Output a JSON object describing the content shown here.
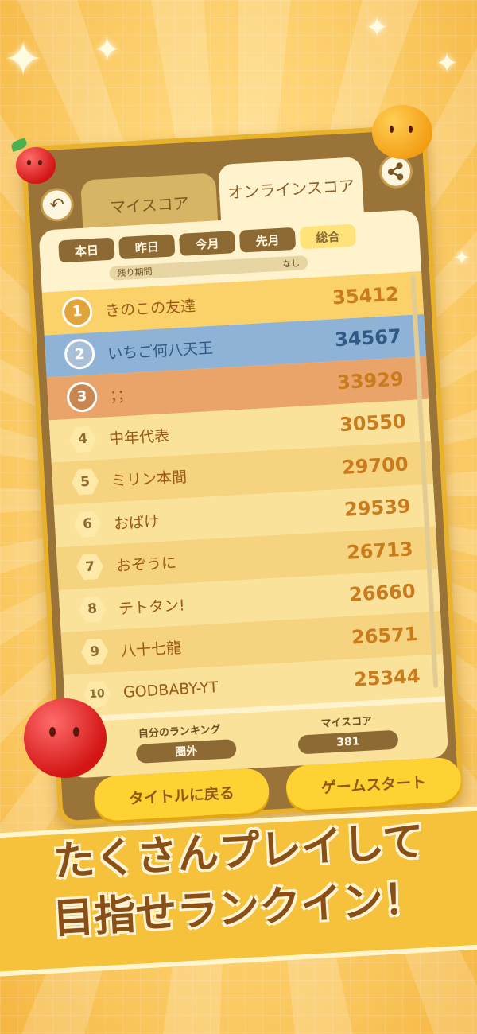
{
  "tabs": {
    "my_score": "マイスコア",
    "online_score": "オンラインスコア"
  },
  "filters": [
    {
      "label": "本日",
      "active": false
    },
    {
      "label": "昨日",
      "active": false
    },
    {
      "label": "今月",
      "active": false
    },
    {
      "label": "先月",
      "active": false
    },
    {
      "label": "総合",
      "active": true
    }
  ],
  "remaining": {
    "label": "残り期間",
    "value": "なし"
  },
  "rankings": [
    {
      "rank": "1",
      "name": "きのこの友達",
      "score": "35412"
    },
    {
      "rank": "2",
      "name": "いちご何八天王",
      "score": "34567"
    },
    {
      "rank": "3",
      "name": "；；",
      "score": "33929"
    },
    {
      "rank": "4",
      "name": "中年代表",
      "score": "30550"
    },
    {
      "rank": "5",
      "name": "ミリン本間",
      "score": "29700"
    },
    {
      "rank": "6",
      "name": "おばけ",
      "score": "29539"
    },
    {
      "rank": "7",
      "name": "おぞうに",
      "score": "26713"
    },
    {
      "rank": "8",
      "name": "テトタン!",
      "score": "26660"
    },
    {
      "rank": "9",
      "name": "八十七龍",
      "score": "26571"
    },
    {
      "rank": "10",
      "name": "GODBABY-YT",
      "score": "25344"
    }
  ],
  "footer": {
    "my_ranking_label": "自分のランキング",
    "my_ranking_value": "圏外",
    "my_score_label": "マイスコア",
    "my_score_value": "381"
  },
  "buttons": {
    "back_to_title": "タイトルに戻る",
    "game_start": "ゲームスタート"
  },
  "banner": {
    "line1": "たくさんプレイして",
    "line2": "目指せランクイン！"
  },
  "colors": {
    "accent": "#ffd233",
    "panel": "#9a7338",
    "gold": "#e0a43a",
    "silver": "#a9bfd8",
    "bronze": "#c98651"
  }
}
